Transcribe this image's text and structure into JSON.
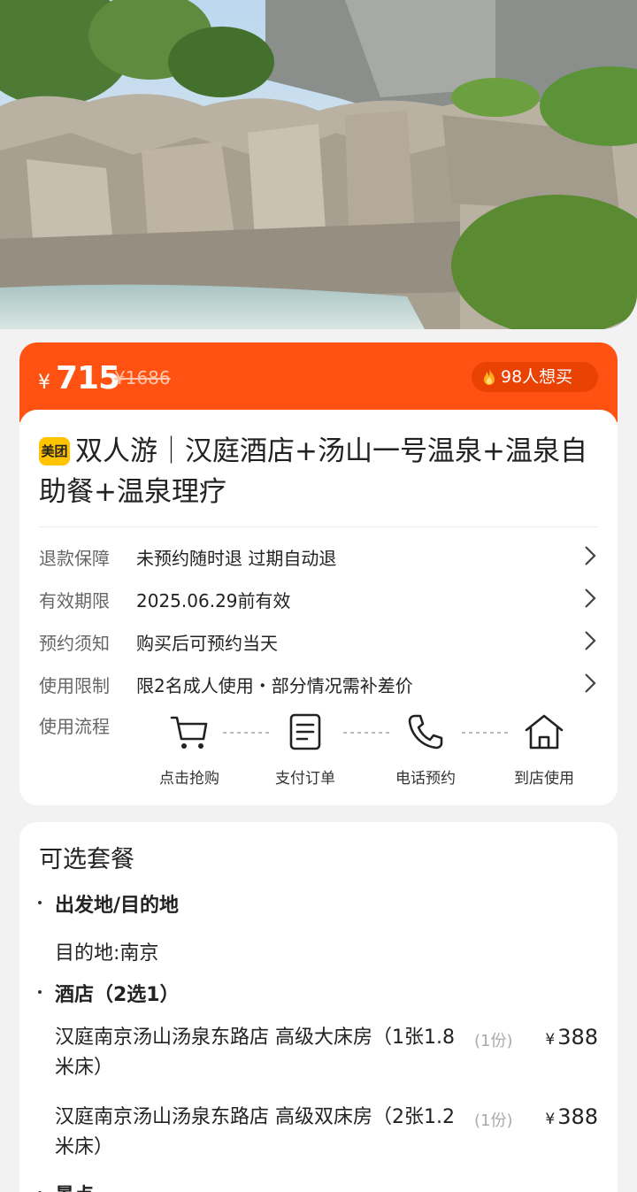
{
  "price": {
    "currency": "¥",
    "current": "715",
    "original": "¥1686",
    "want_text": "98人想买"
  },
  "product": {
    "badge": "美团",
    "title": "双人游｜汉庭酒店+汤山一号温泉+温泉自助餐+温泉理疗"
  },
  "info_rows": [
    {
      "label": "退款保障",
      "value": "未预约随时退 过期自动退"
    },
    {
      "label": "有效期限",
      "value": "2025.06.29前有效"
    },
    {
      "label": "预约须知",
      "value": "购买后可预约当天"
    },
    {
      "label": "使用限制",
      "value": "限2名成人使用・部分情况需补差价"
    }
  ],
  "flow": {
    "label": "使用流程",
    "steps": [
      {
        "icon": "cart-icon",
        "text": "点击抢购"
      },
      {
        "icon": "document-icon",
        "text": "支付订单"
      },
      {
        "icon": "phone-icon",
        "text": "电话预约"
      },
      {
        "icon": "home-icon",
        "text": "到店使用"
      }
    ]
  },
  "packages": {
    "title": "可选套餐",
    "sections": [
      {
        "heading": "出发地/目的地"
      },
      {
        "heading": "酒店（2选1）"
      }
    ],
    "destination": "目的地:南京",
    "items": [
      {
        "name": "汉庭南京汤山汤泉东路店 高级大床房（1张1.8米床）",
        "count": "(1份)",
        "currency": "¥",
        "price": "388"
      },
      {
        "name": "汉庭南京汤山汤泉东路店 高级双床房（2张1.2米床）",
        "count": "(1份)",
        "currency": "¥",
        "price": "388"
      }
    ],
    "next_heading": "景点"
  },
  "colors": {
    "accent": "#ff5212",
    "pill": "#e94203",
    "badge": "#ffc300"
  }
}
